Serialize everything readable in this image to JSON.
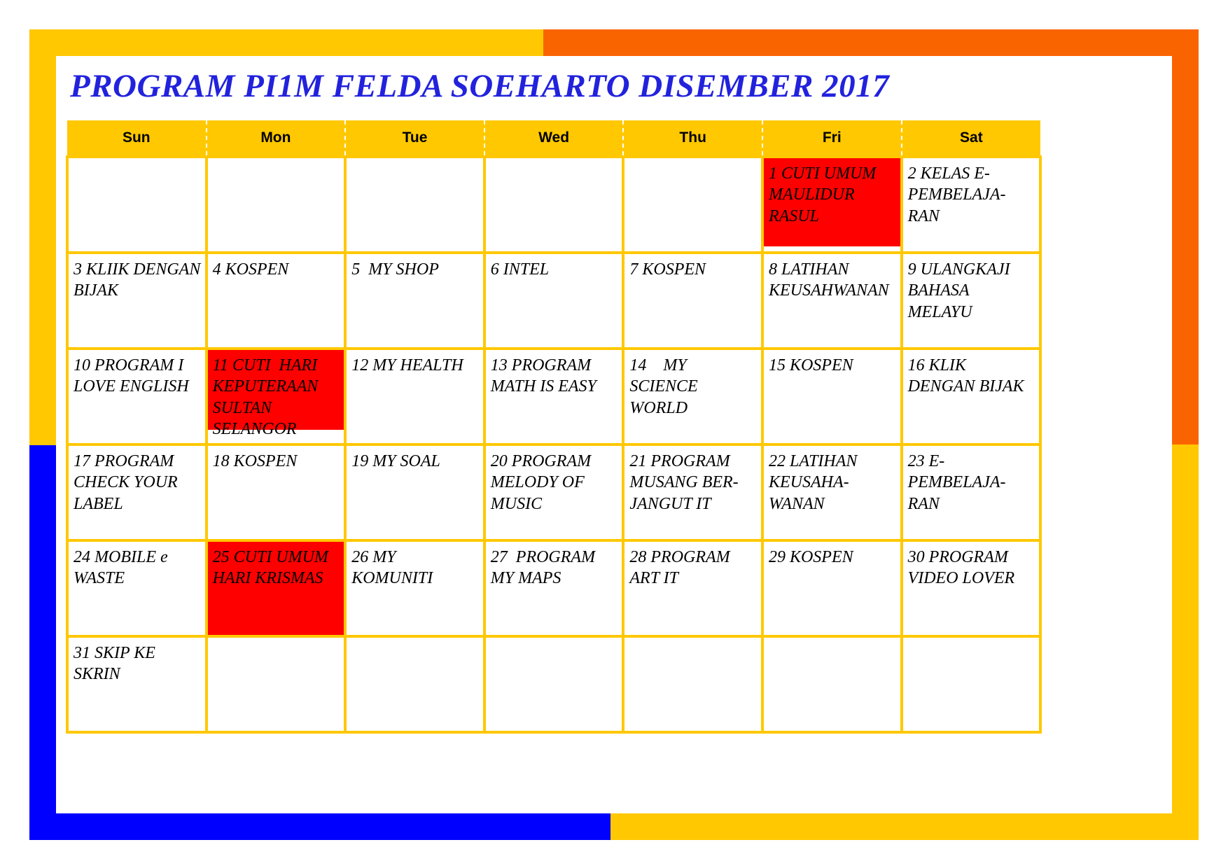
{
  "document": {
    "title": "PROGRAM PI1M FELDA SOEHARTO DISEMBER 2017",
    "type": "monthly-calendar",
    "month": "DISEMBER",
    "year": "2017"
  },
  "colors": {
    "frame_gold": "#FFC800",
    "frame_orange": "#FA6400",
    "frame_blue": "#0000FF",
    "title_blue": "#2222DD",
    "grid_gold": "#FFC800",
    "holiday_red": "#FF0000",
    "cell_background": "#FFFFFF",
    "text_black": "#000000"
  },
  "weekday_headers": [
    "Sun",
    "Mon",
    "Tue",
    "Wed",
    "Thu",
    "Fri",
    "Sat"
  ],
  "weeks": [
    [
      {
        "day": "",
        "text": "",
        "holiday": false
      },
      {
        "day": "",
        "text": "",
        "holiday": false
      },
      {
        "day": "",
        "text": "",
        "holiday": false
      },
      {
        "day": "",
        "text": "",
        "holiday": false
      },
      {
        "day": "",
        "text": "",
        "holiday": false
      },
      {
        "day": "1",
        "text": "1 CUTI UMUM MAULIDUR RASUL",
        "holiday": true,
        "fill": "h-95"
      },
      {
        "day": "2",
        "text": "2 KELAS E-PEMBELAJA-RAN",
        "holiday": false
      }
    ],
    [
      {
        "day": "3",
        "text": "3 KLIIK DENGAN BIJAK",
        "holiday": false
      },
      {
        "day": "4",
        "text": "4 KOSPEN",
        "holiday": false
      },
      {
        "day": "5",
        "text": "5  MY SHOP",
        "holiday": false
      },
      {
        "day": "6",
        "text": "6 INTEL",
        "holiday": false
      },
      {
        "day": "7",
        "text": "7 KOSPEN",
        "holiday": false
      },
      {
        "day": "8",
        "text": "8 LATIHAN KEUSAHWANAN",
        "holiday": false
      },
      {
        "day": "9",
        "text": "9 ULANGKAJI BAHASA  MELAYU",
        "holiday": false
      }
    ],
    [
      {
        "day": "10",
        "text": "10 PROGRAM I LOVE ENGLISH",
        "holiday": false
      },
      {
        "day": "11",
        "text": "11 CUTI  HARI KEPUTERAAN SULTAN SELANGOR",
        "holiday": true,
        "fill": "h-86"
      },
      {
        "day": "12",
        "text": "12 MY HEALTH",
        "holiday": false
      },
      {
        "day": "13",
        "text": "13 PROGRAM MATH IS EASY",
        "holiday": false
      },
      {
        "day": "14",
        "text": "14    MY SCIENCE WORLD",
        "holiday": false
      },
      {
        "day": "15",
        "text": "15 KOSPEN",
        "holiday": false
      },
      {
        "day": "16",
        "text": "16 KLIK DENGAN BIJAK",
        "holiday": false
      }
    ],
    [
      {
        "day": "17",
        "text": "17 PROGRAM CHECK YOUR LABEL",
        "holiday": false
      },
      {
        "day": "18",
        "text": "18 KOSPEN",
        "holiday": false
      },
      {
        "day": "19",
        "text": "19 MY SOAL",
        "holiday": false
      },
      {
        "day": "20",
        "text": "20 PROGRAM MELODY OF MUSIC",
        "holiday": false
      },
      {
        "day": "21",
        "text": "21 PROGRAM MUSANG BER-JANGUT IT",
        "holiday": false
      },
      {
        "day": "22",
        "text": "22 LATIHAN KEUSAHA-WANAN",
        "holiday": false
      },
      {
        "day": "23",
        "text": "23 E-PEMBELAJA-RAN",
        "holiday": false
      }
    ],
    [
      {
        "day": "24",
        "text": "24 MOBILE e WASTE",
        "holiday": false
      },
      {
        "day": "25",
        "text": "25 CUTI UMUM HARI KRISMAS",
        "holiday": true,
        "fill": "h-full"
      },
      {
        "day": "26",
        "text": "26 MY KOMUNITI",
        "holiday": false
      },
      {
        "day": "27",
        "text": "27  PROGRAM MY MAPS",
        "holiday": false
      },
      {
        "day": "28",
        "text": "28 PROGRAM ART IT",
        "holiday": false
      },
      {
        "day": "29",
        "text": "29 KOSPEN",
        "holiday": false
      },
      {
        "day": "30",
        "text": "30 PROGRAM VIDEO LOVER",
        "holiday": false
      }
    ],
    [
      {
        "day": "31",
        "text": "31 SKIP KE SKRIN",
        "holiday": false
      },
      {
        "day": "",
        "text": "",
        "holiday": false
      },
      {
        "day": "",
        "text": "",
        "holiday": false
      },
      {
        "day": "",
        "text": "",
        "holiday": false
      },
      {
        "day": "",
        "text": "",
        "holiday": false
      },
      {
        "day": "",
        "text": "",
        "holiday": false
      },
      {
        "day": "",
        "text": "",
        "holiday": false
      }
    ]
  ]
}
